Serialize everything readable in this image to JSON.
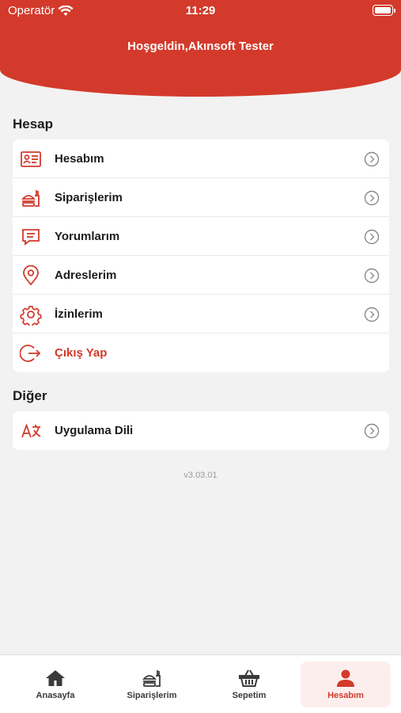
{
  "status_bar": {
    "carrier": "Operatör",
    "time": "11:29"
  },
  "header": {
    "greeting": "Hoşgeldin,Akınsoft Tester",
    "color": "#d33a2b"
  },
  "account_section": {
    "title": "Hesap",
    "items": [
      {
        "label": "Hesabım",
        "icon": "id-card-icon"
      },
      {
        "label": "Siparişlerim",
        "icon": "food-order-icon"
      },
      {
        "label": "Yorumlarım",
        "icon": "comment-icon"
      },
      {
        "label": "Adreslerim",
        "icon": "location-pin-icon"
      },
      {
        "label": "İzinlerim",
        "icon": "gear-icon"
      },
      {
        "label": "Çıkış Yap",
        "icon": "logout-icon"
      }
    ]
  },
  "other_section": {
    "title": "Diğer",
    "items": [
      {
        "label": "Uygulama Dili",
        "icon": "translate-icon"
      }
    ]
  },
  "version": "v3.03.01",
  "tabbar": {
    "tabs": [
      {
        "label": "Anasayfa",
        "icon": "home-icon"
      },
      {
        "label": "Siparişlerim",
        "icon": "food-order-icon"
      },
      {
        "label": "Sepetim",
        "icon": "basket-icon"
      },
      {
        "label": "Hesabım",
        "icon": "user-icon",
        "active": true
      }
    ]
  },
  "colors": {
    "accent": "#d33a2b",
    "background": "#f2f2f2"
  }
}
